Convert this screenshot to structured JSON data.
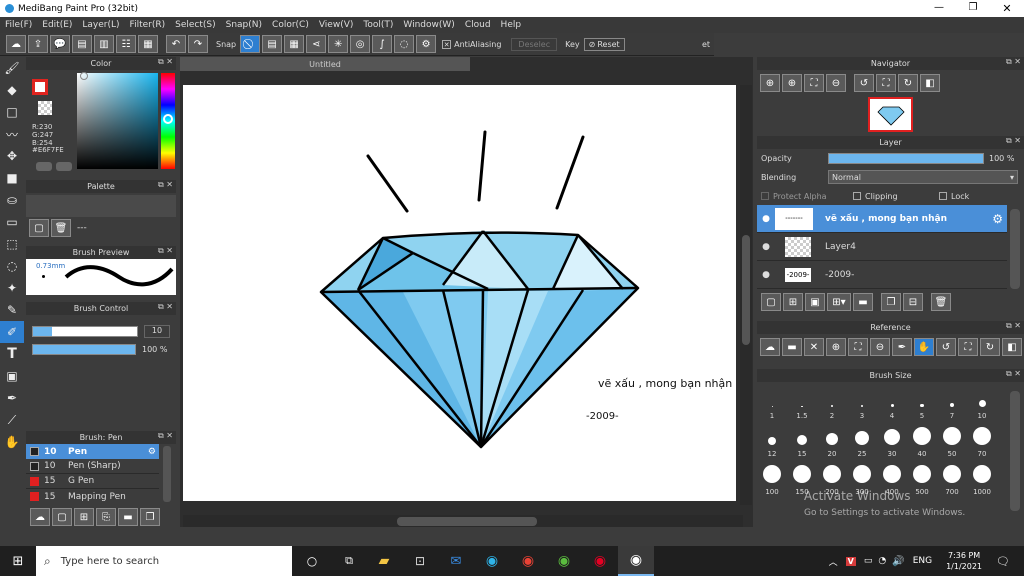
{
  "app": {
    "title": "MediBang Paint Pro (32bit)"
  },
  "menu": [
    "File(F)",
    "Edit(E)",
    "Layer(L)",
    "Filter(R)",
    "Select(S)",
    "Snap(N)",
    "Color(C)",
    "View(V)",
    "Tool(T)",
    "Window(W)",
    "Cloud",
    "Help"
  ],
  "toolbar": {
    "snap_label": "Snap",
    "antialias_label": "AntiAliasing",
    "deselect_label": "Deselec",
    "key_label": "Key",
    "reset_label": "Reset",
    "overflow_label": "et"
  },
  "document": {
    "tab": "Untitled"
  },
  "panels": {
    "color": "Color",
    "palette": "Palette",
    "brush_preview": "Brush Preview",
    "brush_control": "Brush Control",
    "brush_list": "Brush: Pen",
    "navigator": "Navigator",
    "layer": "Layer",
    "reference": "Reference",
    "brush_size": "Brush Size"
  },
  "color": {
    "r": "R:230",
    "g": "G:247",
    "b": "B:254",
    "hex": "#E6F7FE",
    "primary": "#e0241f",
    "field": "#19b6f0"
  },
  "palette": {
    "dash": "---"
  },
  "brush_preview": {
    "size": "0.73mm"
  },
  "brush_control": {
    "size_value": "10",
    "opacity_value": "100 %"
  },
  "brushes": [
    {
      "size": "10",
      "name": "Pen",
      "color": "#222222",
      "selected": true
    },
    {
      "size": "10",
      "name": "Pen (Sharp)",
      "color": "#222222",
      "selected": false
    },
    {
      "size": "15",
      "name": "G Pen",
      "color": "#e02020",
      "selected": false
    },
    {
      "size": "15",
      "name": "Mapping Pen",
      "color": "#e02020",
      "selected": false
    }
  ],
  "layer": {
    "opacity_label": "Opacity",
    "opacity_value": "100 %",
    "blending_label": "Blending",
    "blending_value": "Normal",
    "protect_alpha": "Protect Alpha",
    "clipping": "Clipping",
    "lock": "Lock",
    "layers": [
      {
        "name": "vẽ xấu , mong bạn nhận",
        "thumb": "-------",
        "selected": true
      },
      {
        "name": "Layer4",
        "thumb": "",
        "selected": false
      },
      {
        "name": "-2009-",
        "thumb": "-2009-",
        "selected": false
      }
    ]
  },
  "brush_size": {
    "rows": [
      [
        {
          "label": "1",
          "d": 1
        },
        {
          "label": "1.5",
          "d": 1.5
        },
        {
          "label": "2",
          "d": 2
        },
        {
          "label": "3",
          "d": 2.5
        },
        {
          "label": "4",
          "d": 3
        },
        {
          "label": "5",
          "d": 3.5
        },
        {
          "label": "7",
          "d": 4.5
        },
        {
          "label": "10",
          "d": 7
        }
      ],
      [
        {
          "label": "12",
          "d": 8
        },
        {
          "label": "15",
          "d": 10
        },
        {
          "label": "20",
          "d": 12
        },
        {
          "label": "25",
          "d": 14
        },
        {
          "label": "30",
          "d": 16
        },
        {
          "label": "40",
          "d": 18
        },
        {
          "label": "50",
          "d": 18
        },
        {
          "label": "70",
          "d": 18
        }
      ],
      [
        {
          "label": "100",
          "d": 18
        },
        {
          "label": "150",
          "d": 18
        },
        {
          "label": "200",
          "d": 18
        },
        {
          "label": "300",
          "d": 18
        },
        {
          "label": "400",
          "d": 18
        },
        {
          "label": "500",
          "d": 18
        },
        {
          "label": "700",
          "d": 18
        },
        {
          "label": "1000",
          "d": 18
        }
      ]
    ]
  },
  "canvas_text": {
    "line1": "vẽ xấu , mong bạn nhận",
    "line2": "-2009-"
  },
  "watermark": {
    "title": "Activate Windows",
    "subtitle": "Go to Settings to activate Windows."
  },
  "taskbar": {
    "search_placeholder": "Type here to search",
    "time": "7:36 PM",
    "date": "1/1/2021",
    "lang": "ENG"
  }
}
